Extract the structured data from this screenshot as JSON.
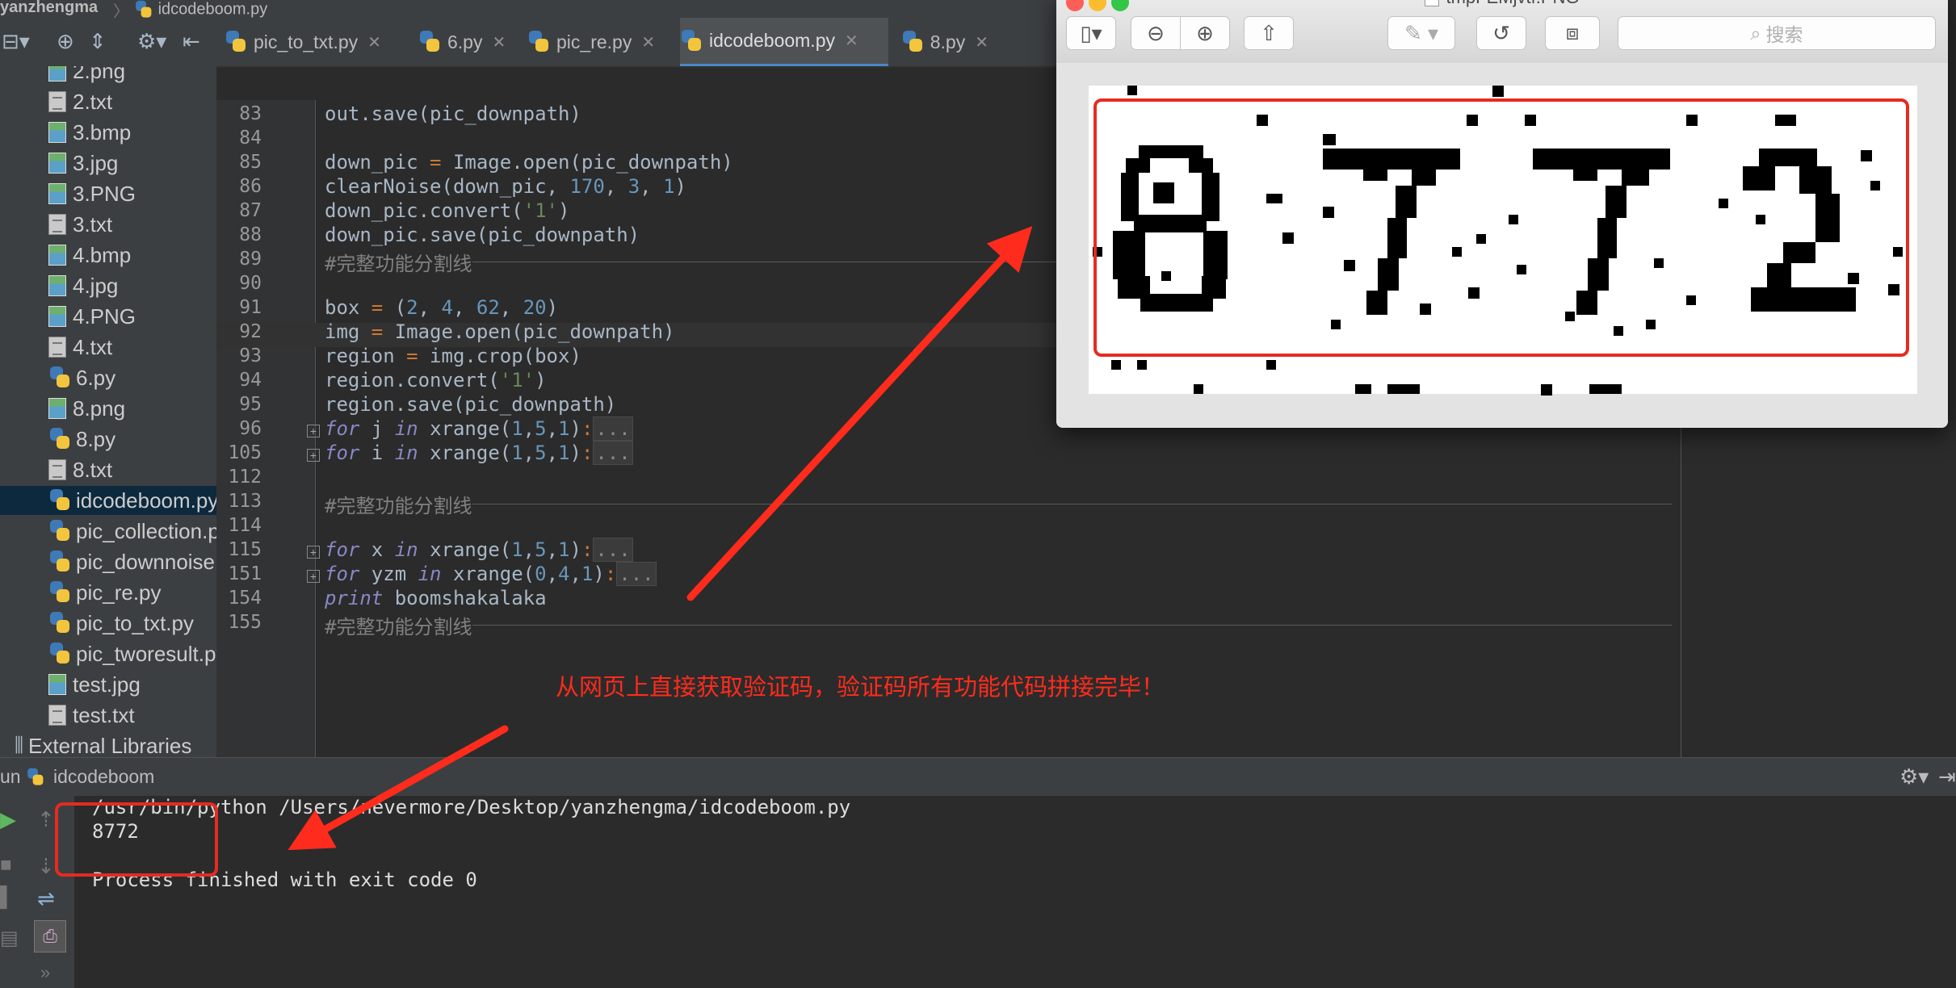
{
  "breadcrumb": {
    "project": "yanzhengma",
    "file": "idcodeboom.py"
  },
  "tabs": [
    {
      "label": "pic_to_txt.py",
      "active": false
    },
    {
      "label": "6.py",
      "active": false
    },
    {
      "label": "pic_re.py",
      "active": false
    },
    {
      "label": "idcodeboom.py",
      "active": true
    },
    {
      "label": "8.py",
      "active": false
    }
  ],
  "project_tree": [
    {
      "label": "2.png",
      "icon": "image-file-icon"
    },
    {
      "label": "2.txt",
      "icon": "text-file-icon"
    },
    {
      "label": "3.bmp",
      "icon": "image-file-icon"
    },
    {
      "label": "3.jpg",
      "icon": "image-file-icon"
    },
    {
      "label": "3.PNG",
      "icon": "image-file-icon"
    },
    {
      "label": "3.txt",
      "icon": "text-file-icon"
    },
    {
      "label": "4.bmp",
      "icon": "image-file-icon"
    },
    {
      "label": "4.jpg",
      "icon": "image-file-icon"
    },
    {
      "label": "4.PNG",
      "icon": "image-file-icon"
    },
    {
      "label": "4.txt",
      "icon": "text-file-icon"
    },
    {
      "label": "6.py",
      "icon": "python-file-icon"
    },
    {
      "label": "8.png",
      "icon": "image-file-icon"
    },
    {
      "label": "8.py",
      "icon": "python-file-icon"
    },
    {
      "label": "8.txt",
      "icon": "text-file-icon"
    },
    {
      "label": "idcodeboom.py",
      "icon": "python-file-icon",
      "selected": true
    },
    {
      "label": "pic_collection.py",
      "icon": "python-file-icon"
    },
    {
      "label": "pic_downnoise.py",
      "icon": "python-file-icon"
    },
    {
      "label": "pic_re.py",
      "icon": "python-file-icon"
    },
    {
      "label": "pic_to_txt.py",
      "icon": "python-file-icon"
    },
    {
      "label": "pic_tworesult.py",
      "icon": "python-file-icon"
    },
    {
      "label": "test.jpg",
      "icon": "image-file-icon"
    },
    {
      "label": "test.txt",
      "icon": "text-file-icon"
    },
    {
      "label": "External Libraries",
      "icon": "library-icon"
    }
  ],
  "code_lines": [
    {
      "num": "83",
      "tokens": [
        [
          "nm",
          "out.save(pic_downpath)"
        ]
      ]
    },
    {
      "num": "84",
      "tokens": []
    },
    {
      "num": "85",
      "tokens": [
        [
          "nm",
          "down_pic "
        ],
        [
          "op",
          "="
        ],
        [
          "nm",
          " Image.open(pic_downpath)"
        ]
      ]
    },
    {
      "num": "86",
      "tokens": [
        [
          "nm",
          "clearNoise(down_pic, "
        ],
        [
          "num",
          "170"
        ],
        [
          "nm",
          ", "
        ],
        [
          "num",
          "3"
        ],
        [
          "nm",
          ", "
        ],
        [
          "num",
          "1"
        ],
        [
          "nm",
          ")"
        ]
      ]
    },
    {
      "num": "87",
      "tokens": [
        [
          "nm",
          "down_pic.convert("
        ],
        [
          "str",
          "'1'"
        ],
        [
          "nm",
          ")"
        ]
      ]
    },
    {
      "num": "88",
      "tokens": [
        [
          "nm",
          "down_pic.save(pic_downpath)"
        ]
      ]
    },
    {
      "num": "89",
      "tokens": [
        [
          "cmt",
          "#完整功能分割线"
        ]
      ],
      "separator": true
    },
    {
      "num": "90",
      "tokens": []
    },
    {
      "num": "91",
      "tokens": [
        [
          "nm",
          "box "
        ],
        [
          "op",
          "="
        ],
        [
          "nm",
          " ("
        ],
        [
          "num",
          "2"
        ],
        [
          "nm",
          ", "
        ],
        [
          "num",
          "4"
        ],
        [
          "nm",
          ", "
        ],
        [
          "num",
          "62"
        ],
        [
          "nm",
          ", "
        ],
        [
          "num",
          "20"
        ],
        [
          "nm",
          ")"
        ]
      ]
    },
    {
      "num": "92",
      "tokens": [
        [
          "nm",
          "img "
        ],
        [
          "op",
          "="
        ],
        [
          "nm",
          " Image.open(pic_downpath)"
        ]
      ],
      "current": true
    },
    {
      "num": "93",
      "tokens": [
        [
          "nm",
          "region "
        ],
        [
          "op",
          "="
        ],
        [
          "nm",
          " img.crop(box)"
        ]
      ]
    },
    {
      "num": "94",
      "tokens": [
        [
          "nm",
          "region.convert("
        ],
        [
          "str",
          "'1'"
        ],
        [
          "nm",
          ")"
        ]
      ]
    },
    {
      "num": "95",
      "tokens": [
        [
          "nm",
          "region.save(pic_downpath)"
        ]
      ]
    },
    {
      "num": "96",
      "tokens": [
        [
          "kwi",
          "for"
        ],
        [
          "nm",
          " j "
        ],
        [
          "kwi",
          "in"
        ],
        [
          "nm",
          " xrange("
        ],
        [
          "num",
          "1"
        ],
        [
          "nm",
          ","
        ],
        [
          "num",
          "5"
        ],
        [
          "nm",
          ","
        ],
        [
          "num",
          "1"
        ],
        [
          "nm",
          ")"
        ],
        [
          "op",
          ":"
        ],
        [
          "dots",
          "..."
        ]
      ],
      "fold": true
    },
    {
      "num": "105",
      "tokens": [
        [
          "kwi",
          "for"
        ],
        [
          "nm",
          " i "
        ],
        [
          "kwi",
          "in"
        ],
        [
          "nm",
          " xrange("
        ],
        [
          "num",
          "1"
        ],
        [
          "nm",
          ","
        ],
        [
          "num",
          "5"
        ],
        [
          "nm",
          ","
        ],
        [
          "num",
          "1"
        ],
        [
          "nm",
          ")"
        ],
        [
          "op",
          ":"
        ],
        [
          "dots",
          "..."
        ]
      ],
      "fold": true
    },
    {
      "num": "112",
      "tokens": []
    },
    {
      "num": "113",
      "tokens": [
        [
          "cmt",
          "#完整功能分割线"
        ]
      ],
      "separator": true
    },
    {
      "num": "114",
      "tokens": []
    },
    {
      "num": "115",
      "tokens": [
        [
          "kwi",
          "for"
        ],
        [
          "nm",
          " x "
        ],
        [
          "kwi",
          "in"
        ],
        [
          "nm",
          " xrange("
        ],
        [
          "num",
          "1"
        ],
        [
          "nm",
          ","
        ],
        [
          "num",
          "5"
        ],
        [
          "nm",
          ","
        ],
        [
          "num",
          "1"
        ],
        [
          "nm",
          ")"
        ],
        [
          "op",
          ":"
        ],
        [
          "dots",
          "..."
        ]
      ],
      "fold": true
    },
    {
      "num": "151",
      "tokens": [
        [
          "kwi",
          "for"
        ],
        [
          "nm",
          " yzm "
        ],
        [
          "kwi",
          "in"
        ],
        [
          "nm",
          " xrange("
        ],
        [
          "num",
          "0"
        ],
        [
          "nm",
          ","
        ],
        [
          "num",
          "4"
        ],
        [
          "nm",
          ","
        ],
        [
          "num",
          "1"
        ],
        [
          "nm",
          ")"
        ],
        [
          "op",
          ":"
        ],
        [
          "dots",
          "..."
        ]
      ],
      "fold": true
    },
    {
      "num": "154",
      "tokens": [
        [
          "kwi",
          "print"
        ],
        [
          "nm",
          " boomshakalaka"
        ]
      ]
    },
    {
      "num": "155",
      "tokens": [
        [
          "cmt",
          "#完整功能分割线"
        ]
      ],
      "separator": true
    }
  ],
  "annotation": "从网页上直接获取验证码，验证码所有功能代码拼接完毕！",
  "preview": {
    "title": "tmpFEMjvtf.PNG",
    "search_placeholder": "搜索"
  },
  "run": {
    "label": "Run",
    "config": "idcodeboom",
    "output": [
      "/usr/bin/python /Users/nevermore/Desktop/yanzhengma/idcodeboom.py",
      "8772",
      "",
      "Process finished with exit code 0"
    ]
  },
  "colors": {
    "accent_red": "#e52b22",
    "selection": "#0d293e",
    "tab_active_underline": "#4a88c7"
  }
}
